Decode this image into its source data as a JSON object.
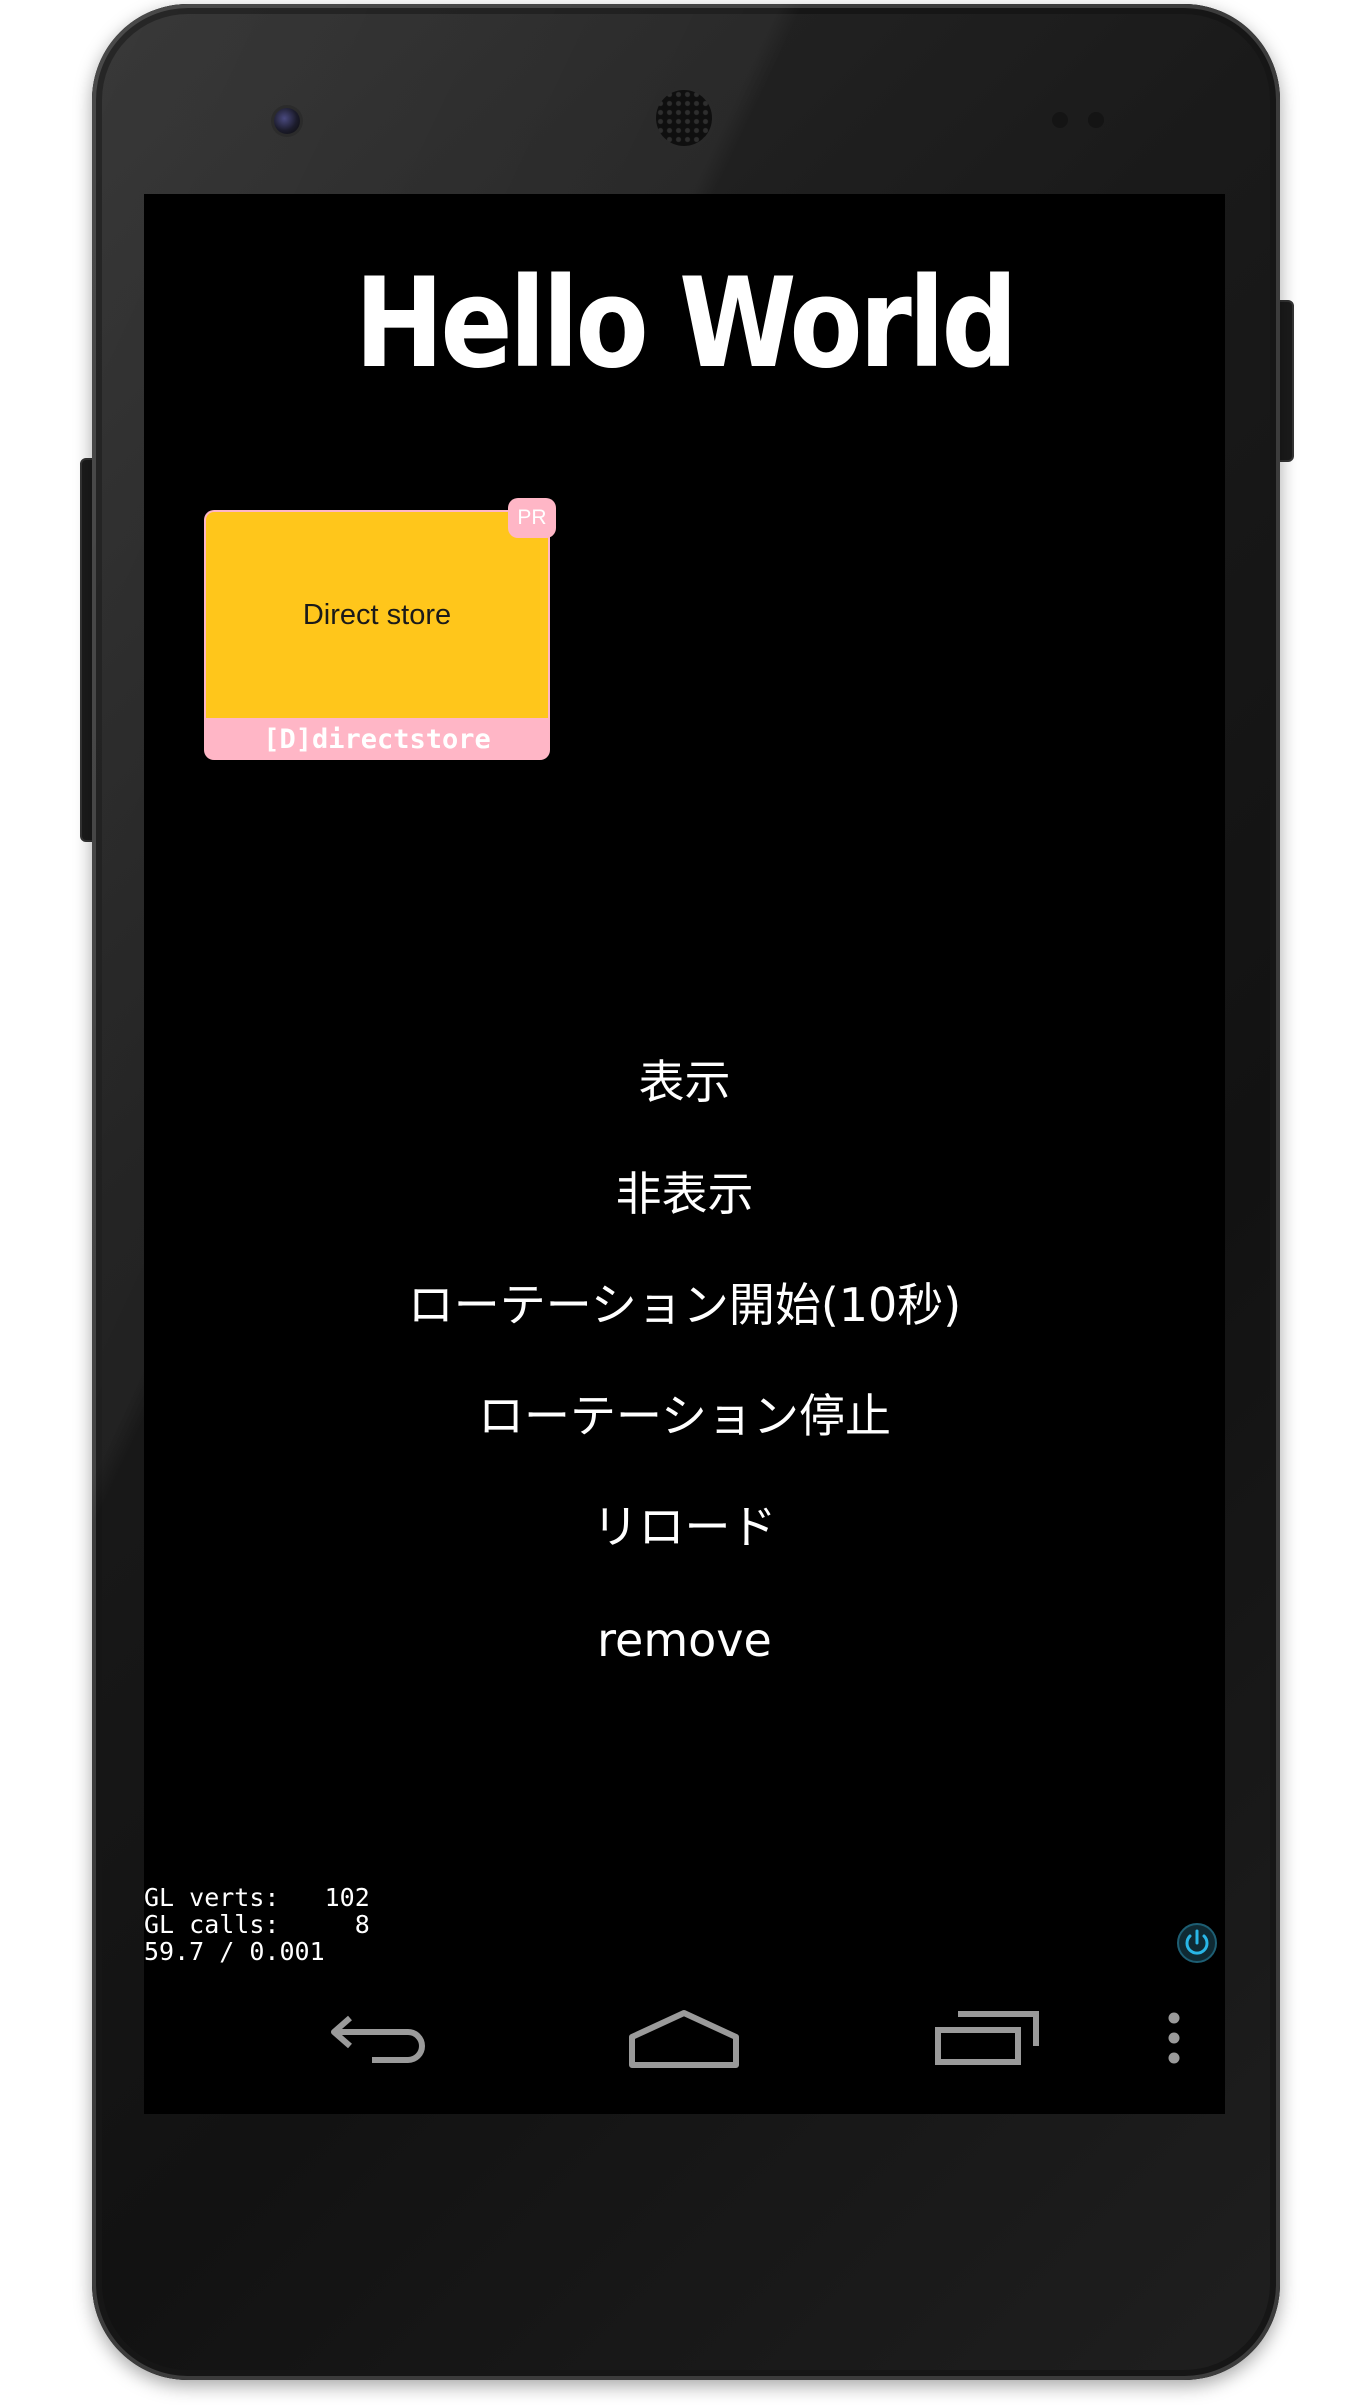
{
  "app": {
    "title": "Hello World"
  },
  "ad": {
    "text": "Direct store",
    "caption": "[D]directstore",
    "badge": "PR",
    "colors": {
      "background": "#ffc61b",
      "frame": "#ffb6c6"
    }
  },
  "menu": {
    "items": [
      {
        "label": "表示"
      },
      {
        "label": "非表示"
      },
      {
        "label": "ローテーション開始(10秒)"
      },
      {
        "label": "ローテーション停止"
      },
      {
        "label": "リロード"
      },
      {
        "label": "remove"
      }
    ]
  },
  "debug": {
    "line1": "GL verts:   102",
    "line2": "GL calls:     8",
    "line3": "59.7 / 0.001"
  },
  "icons": {
    "power": "power-icon",
    "back": "back-icon",
    "home": "home-icon",
    "recents": "recents-icon",
    "overflow": "overflow-menu-icon"
  },
  "colors": {
    "screen_background": "#000000",
    "text": "#ffffff",
    "power_accent": "#29b6e6",
    "nav_icon": "#9a9a9a"
  }
}
